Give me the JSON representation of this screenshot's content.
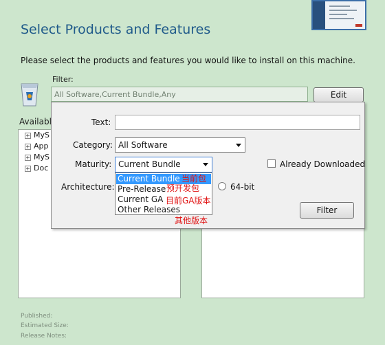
{
  "page": {
    "title": "Select Products and Features",
    "subtitle": "Please select the products and features you would like to install on this machine."
  },
  "filter": {
    "label": "Filter:",
    "value": "All Software,Current Bundle,Any",
    "edit_button": "Edit"
  },
  "available": {
    "label": "Available",
    "items": [
      "MyS",
      "App",
      "MyS",
      "Doc"
    ]
  },
  "popup": {
    "text_label": "Text:",
    "text_value": "",
    "category_label": "Category:",
    "category_value": "All Software",
    "maturity_label": "Maturity:",
    "maturity_value": "Current Bundle",
    "maturity_options": [
      "Current Bundle",
      "Pre-Release",
      "Current GA",
      "Other Releases"
    ],
    "architecture_label": "Architecture:",
    "arch_option": "64-bit",
    "already_downloaded_label": "Already Downloaded",
    "filter_button": "Filter"
  },
  "annotations": [
    "当前包",
    "预开发包",
    "目前GA版本",
    "其他版本"
  ],
  "details": {
    "published_label": "Published:",
    "size_label": "Estimated Size:",
    "notes_label": "Release Notes:"
  },
  "colors": {
    "background": "#cde6cd",
    "title": "#1f5a8a",
    "selection": "#3399ff",
    "annotation": "#e01010"
  }
}
